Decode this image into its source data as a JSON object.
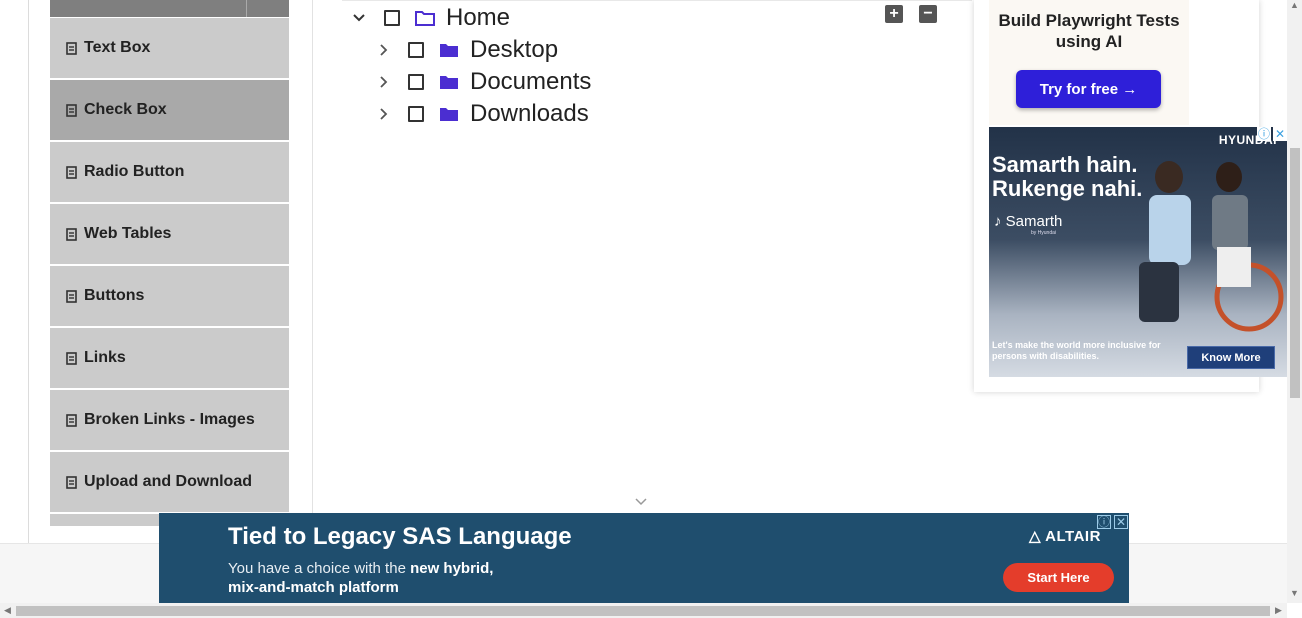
{
  "sidebar": {
    "items": [
      {
        "label": "Text Box",
        "active": false
      },
      {
        "label": "Check Box",
        "active": true
      },
      {
        "label": "Radio Button",
        "active": false
      },
      {
        "label": "Web Tables",
        "active": false
      },
      {
        "label": "Buttons",
        "active": false
      },
      {
        "label": "Links",
        "active": false
      },
      {
        "label": "Broken Links - Images",
        "active": false
      },
      {
        "label": "Upload and Download",
        "active": false
      }
    ],
    "item_icon": "file-icon"
  },
  "tree": {
    "toolbar": {
      "expand_all": "+",
      "collapse_all": "−"
    },
    "root": {
      "label": "Home",
      "expanded": true,
      "checked": false
    },
    "children": [
      {
        "label": "Desktop",
        "expanded": false,
        "checked": false
      },
      {
        "label": "Documents",
        "expanded": false,
        "checked": false
      },
      {
        "label": "Downloads",
        "expanded": false,
        "checked": false
      }
    ]
  },
  "ads": {
    "playwright": {
      "title": "Build Playwright Tests using AI",
      "button": "Try for free →"
    },
    "hyundai": {
      "brand": "HYUNDAI",
      "headline": "Samarth hain. Rukenge nahi.",
      "logo": "Samarth",
      "logo_sub": "by Hyundai",
      "footer": "Let's make the world more inclusive for persons with disabilities.",
      "button": "Know More"
    },
    "altair": {
      "title": "Tied to Legacy SAS Language",
      "sub_prefix": "You have a choice with the ",
      "sub_bold1": "new hybrid,",
      "sub_bold2": "mix-and-match platform",
      "brand": "ALTAIR",
      "button": "Start Here"
    }
  },
  "colors": {
    "accent_folder": "#4b2ed1",
    "sidebar_bg": "#cbcbcb",
    "sidebar_active": "#a9a9a9",
    "altair_bg": "#1f4e6e",
    "cta_red": "#e43d2b",
    "cta_blue": "#2e1fd9"
  }
}
